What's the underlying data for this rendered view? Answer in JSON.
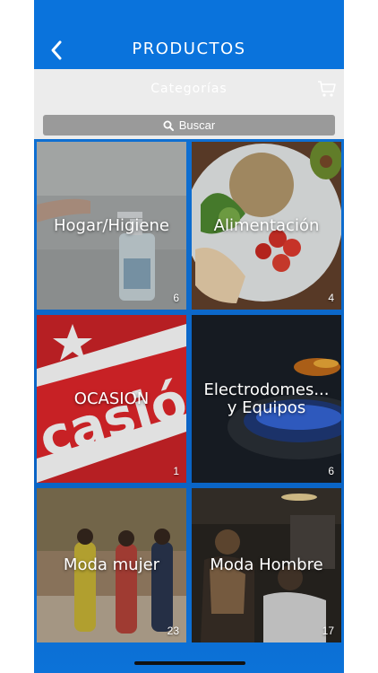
{
  "header": {
    "title": "PRODUCTOS",
    "back_icon": "chevron-left-icon"
  },
  "subheader": {
    "title": "Categorías",
    "cart_icon": "cart-icon"
  },
  "search": {
    "label": "Buscar",
    "icon": "search-icon"
  },
  "categories": [
    {
      "label": "Hogar/Higiene",
      "count": "6"
    },
    {
      "label": "Alimentación",
      "count": "4"
    },
    {
      "label": "OCASION",
      "count": "1"
    },
    {
      "label": "Electrodomes...\ny Equipos",
      "count": "6"
    },
    {
      "label": "Moda mujer",
      "count": "23"
    },
    {
      "label": "Moda Hombre",
      "count": "17"
    }
  ],
  "colors": {
    "brand": "#0a73dc",
    "subbar": "#ececec",
    "search_bg": "#9a9a9a"
  }
}
